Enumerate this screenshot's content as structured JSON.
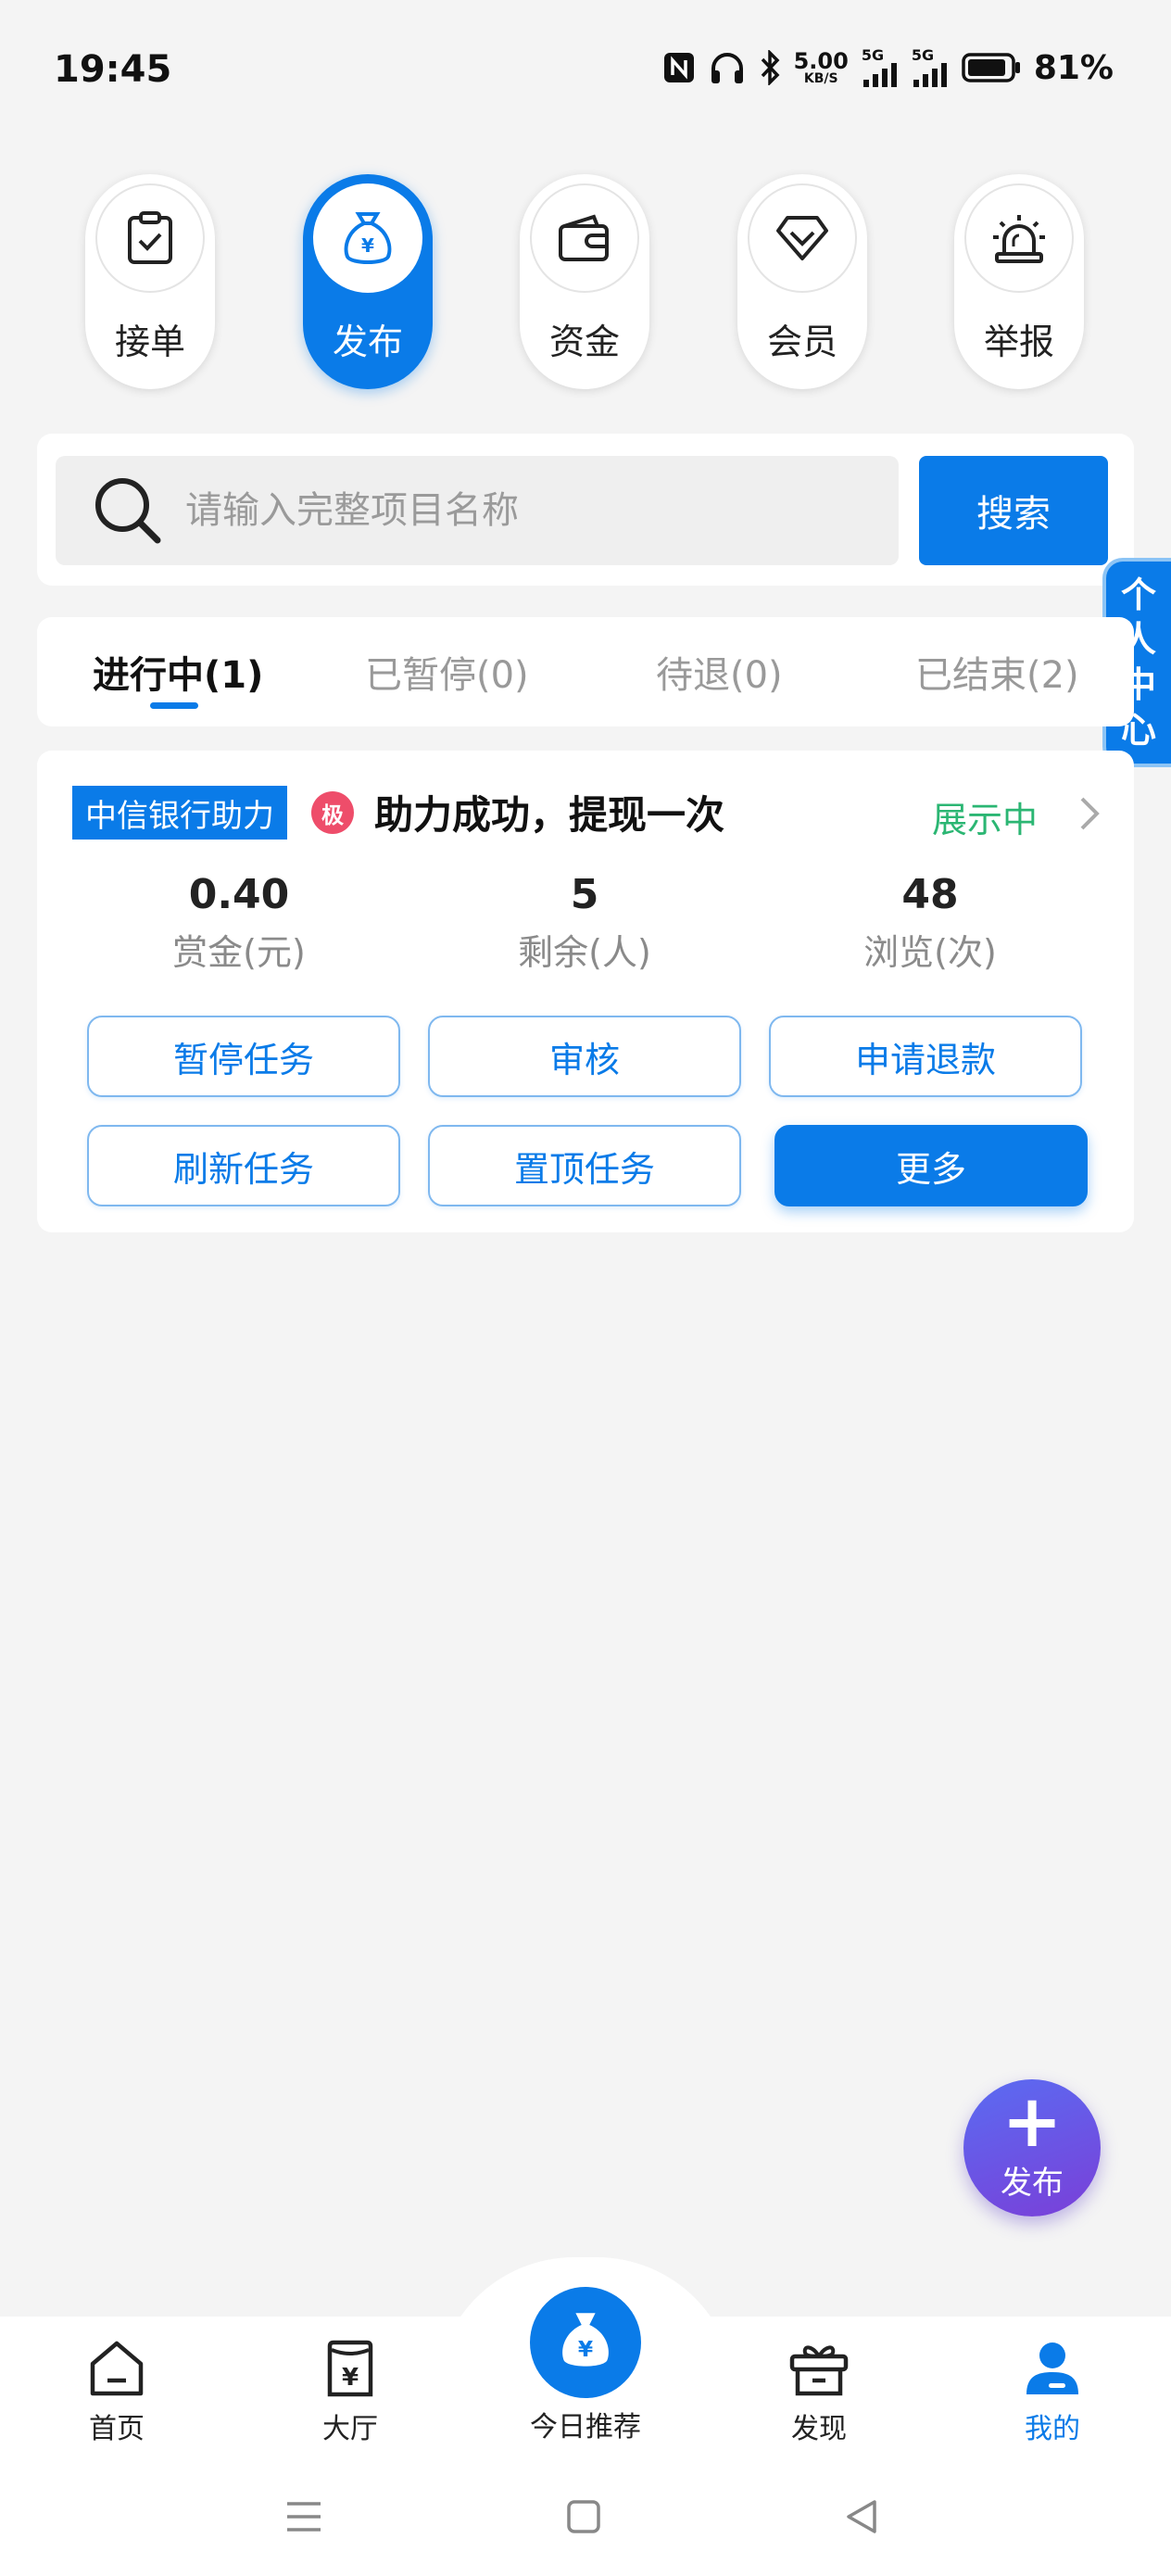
{
  "status_bar": {
    "time": "19:45",
    "speed_value": "5.00",
    "speed_unit": "KB/S",
    "net1": "5G",
    "net2": "5G",
    "battery": "81%"
  },
  "top_nav": [
    {
      "label": "接单",
      "icon": "clipboard-check-icon"
    },
    {
      "label": "发布",
      "icon": "money-bag-icon",
      "active": true
    },
    {
      "label": "资金",
      "icon": "wallet-icon"
    },
    {
      "label": "会员",
      "icon": "diamond-icon"
    },
    {
      "label": "举报",
      "icon": "alarm-siren-icon"
    }
  ],
  "search": {
    "placeholder": "请输入完整项目名称",
    "button": "搜索"
  },
  "side_tab": {
    "chars": [
      "个",
      "人",
      "中",
      "心"
    ]
  },
  "tabs": [
    {
      "label": "进行中(1)",
      "active": true
    },
    {
      "label": "已暂停(0)"
    },
    {
      "label": "待退(0)"
    },
    {
      "label": "已结束(2)"
    }
  ],
  "task": {
    "tag": "中信银行助力",
    "badge": "极",
    "title": "助力成功，提现一次",
    "status": "展示中",
    "stats": [
      {
        "value": "0.40",
        "label": "赏金(元)"
      },
      {
        "value": "5",
        "label": "剩余(人)"
      },
      {
        "value": "48",
        "label": "浏览(次)"
      }
    ],
    "actions": [
      "暂停任务",
      "审核",
      "申请退款",
      "刷新任务",
      "置顶任务",
      "更多"
    ]
  },
  "fab": {
    "label": "发布"
  },
  "bottom_nav": [
    {
      "label": "首页",
      "icon": "home-icon"
    },
    {
      "label": "大厅",
      "icon": "receipt-yen-icon"
    },
    {
      "label": "今日推荐",
      "icon": "money-bag-icon"
    },
    {
      "label": "发现",
      "icon": "gift-box-icon"
    },
    {
      "label": "我的",
      "icon": "user-icon",
      "active": true
    }
  ],
  "colors": {
    "primary": "#0a7be8",
    "status_green": "#2bb673",
    "badge_red": "#ee4d6a",
    "fab_gradient": [
      "#5a6cf2",
      "#7a3fd8"
    ]
  }
}
